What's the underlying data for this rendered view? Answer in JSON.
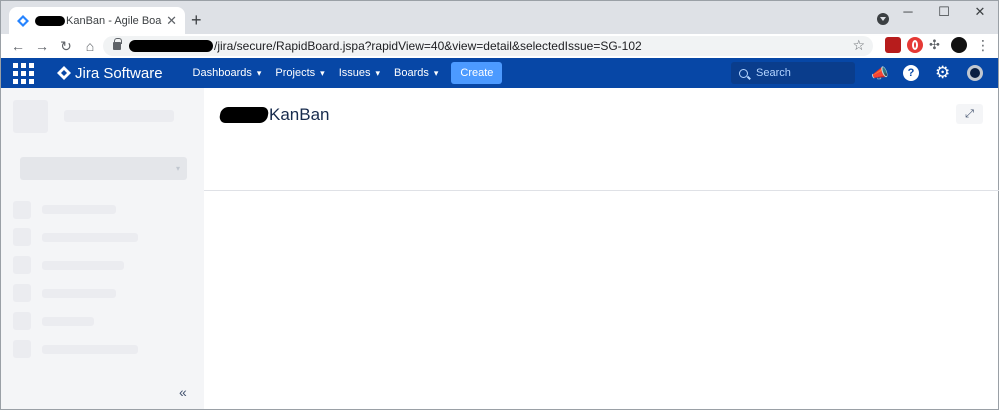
{
  "browser": {
    "tab_title": "KanBan - Agile Board - SI",
    "tab_close": "✕",
    "new_tab": "+",
    "window_controls": {
      "minimize": "─",
      "maximize": "☐",
      "close": "✕"
    },
    "url": "/jira/secure/RapidBoard.jspa?rapidView=40&view=detail&selectedIssue=SG-102",
    "nav": {
      "back": "←",
      "forward": "→",
      "reload": "↻",
      "home": "⌂"
    },
    "star": "☆",
    "extensions_menu": "⋮",
    "puzzle": "✣"
  },
  "jira_nav": {
    "logo_text": "Jira Software",
    "menus": [
      {
        "label": "Dashboards"
      },
      {
        "label": "Projects"
      },
      {
        "label": "Issues"
      },
      {
        "label": "Boards"
      }
    ],
    "chevron": "▾",
    "create_label": "Create",
    "search_placeholder": "Search",
    "help": "?",
    "gear": "⚙",
    "megaphone": "📣",
    "icons": [
      "app-switcher-icon",
      "jira-logo-icon",
      "search-icon",
      "megaphone-icon",
      "help-icon",
      "gear-icon",
      "user-avatar"
    ],
    "colors": {
      "nav_bg": "#0747a6",
      "create_bg": "#4c9aff"
    }
  },
  "board": {
    "title": "KanBan",
    "expand_icon": "⤢",
    "collapse_icon": "«"
  }
}
